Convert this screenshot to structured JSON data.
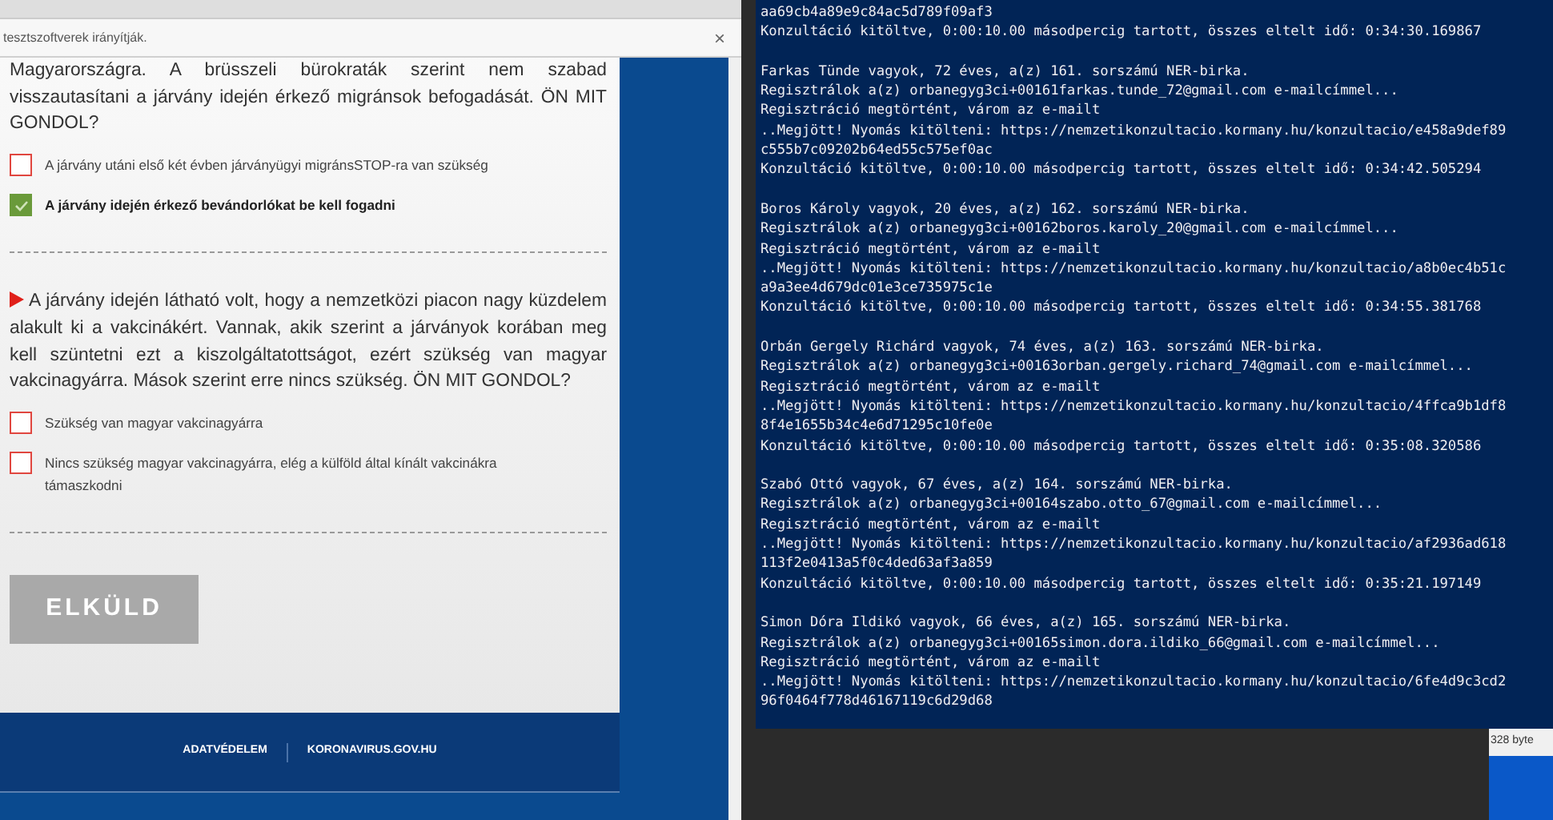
{
  "browser": {
    "infobar": {
      "text": "tesztszoftverek irányítják.",
      "close": "×"
    }
  },
  "form": {
    "questions": [
      {
        "text": "Magyarországra. A brüsszeli bürokraták szerint nem szabad visszautasítani a járvány idején érkező migránsok befogadását. ÖN MIT GONDOL?",
        "marker": false,
        "options": [
          {
            "label": "A járvány utáni első két évben járványügyi migránsSTOP-ra van szükség",
            "checked": false
          },
          {
            "label": "A járvány idején érkező bevándorlókat be kell fogadni",
            "checked": true
          }
        ]
      },
      {
        "text": "A járvány idején látható volt, hogy a nemzetközi piacon nagy küzdelem alakult ki a vakcinákért. Vannak, akik szerint a járványok korában meg kell szüntetni ezt a kiszolgáltatottságot, ezért szükség van magyar vakcinagyárra. Mások szerint erre nincs szükség. ÖN MIT GONDOL?",
        "marker": true,
        "options": [
          {
            "label": "Szükség van magyar vakcinagyárra",
            "checked": false
          },
          {
            "label": "Nincs szükség magyar vakcinagyárra, elég a külföld által kínált vakcinákra támaszkodni",
            "checked": false
          }
        ]
      }
    ],
    "submit": {
      "label": "ELKÜLD",
      "disabled": true
    }
  },
  "footer": {
    "links": [
      "ADATVÉDELEM",
      "KORONAVIRUS.GOV.HU"
    ]
  },
  "console": {
    "blocks": [
      [
        "aa69cb4a89e9c84ac5d789f09af3",
        "Konzultáció kitöltve, 0:00:10.00 másodpercig tartott, összes eltelt idő: 0:34:30.169867"
      ],
      [
        "Farkas Tünde vagyok, 72 éves, a(z) 161. sorszámú NER-birka.",
        "Regisztrálok a(z) orbanegyg3ci+00161farkas.tunde_72@gmail.com e-mailcímmel...",
        "Regisztráció megtörtént, várom az e-mailt",
        "..Megjött! Nyomás kitölteni: https://nemzetikonzultacio.kormany.hu/konzultacio/e458a9def89",
        "c555b7c09202b64ed55c575ef0ac",
        "Konzultáció kitöltve, 0:00:10.00 másodpercig tartott, összes eltelt idő: 0:34:42.505294"
      ],
      [
        "Boros Károly vagyok, 20 éves, a(z) 162. sorszámú NER-birka.",
        "Regisztrálok a(z) orbanegyg3ci+00162boros.karoly_20@gmail.com e-mailcímmel...",
        "Regisztráció megtörtént, várom az e-mailt",
        "..Megjött! Nyomás kitölteni: https://nemzetikonzultacio.kormany.hu/konzultacio/a8b0ec4b51c",
        "a9a3ee4d679dc01e3ce735975c1e",
        "Konzultáció kitöltve, 0:00:10.00 másodpercig tartott, összes eltelt idő: 0:34:55.381768"
      ],
      [
        "Orbán Gergely Richárd vagyok, 74 éves, a(z) 163. sorszámú NER-birka.",
        "Regisztrálok a(z) orbanegyg3ci+00163orban.gergely.richard_74@gmail.com e-mailcímmel...",
        "Regisztráció megtörtént, várom az e-mailt",
        "..Megjött! Nyomás kitölteni: https://nemzetikonzultacio.kormany.hu/konzultacio/4ffca9b1df8",
        "8f4e1655b34c4e6d71295c10fe0e",
        "Konzultáció kitöltve, 0:00:10.00 másodpercig tartott, összes eltelt idő: 0:35:08.320586"
      ],
      [
        "Szabó Ottó vagyok, 67 éves, a(z) 164. sorszámú NER-birka.",
        "Regisztrálok a(z) orbanegyg3ci+00164szabo.otto_67@gmail.com e-mailcímmel...",
        "Regisztráció megtörtént, várom az e-mailt",
        "..Megjött! Nyomás kitölteni: https://nemzetikonzultacio.kormany.hu/konzultacio/af2936ad618",
        "113f2e0413a5f0c4ded63af3a859",
        "Konzultáció kitöltve, 0:00:10.00 másodpercig tartott, összes eltelt idő: 0:35:21.197149"
      ],
      [
        "Simon Dóra Ildikó vagyok, 66 éves, a(z) 165. sorszámú NER-birka.",
        "Regisztrálok a(z) orbanegyg3ci+00165simon.dora.ildiko_66@gmail.com e-mailcímmel...",
        "Regisztráció megtörtént, várom az e-mailt",
        "..Megjött! Nyomás kitölteni: https://nemzetikonzultacio.kormany.hu/konzultacio/6fe4d9c3cd2",
        "96f0464f778d46167119c6d29d68"
      ]
    ]
  },
  "file_panel": {
    "size": "328 byte"
  }
}
